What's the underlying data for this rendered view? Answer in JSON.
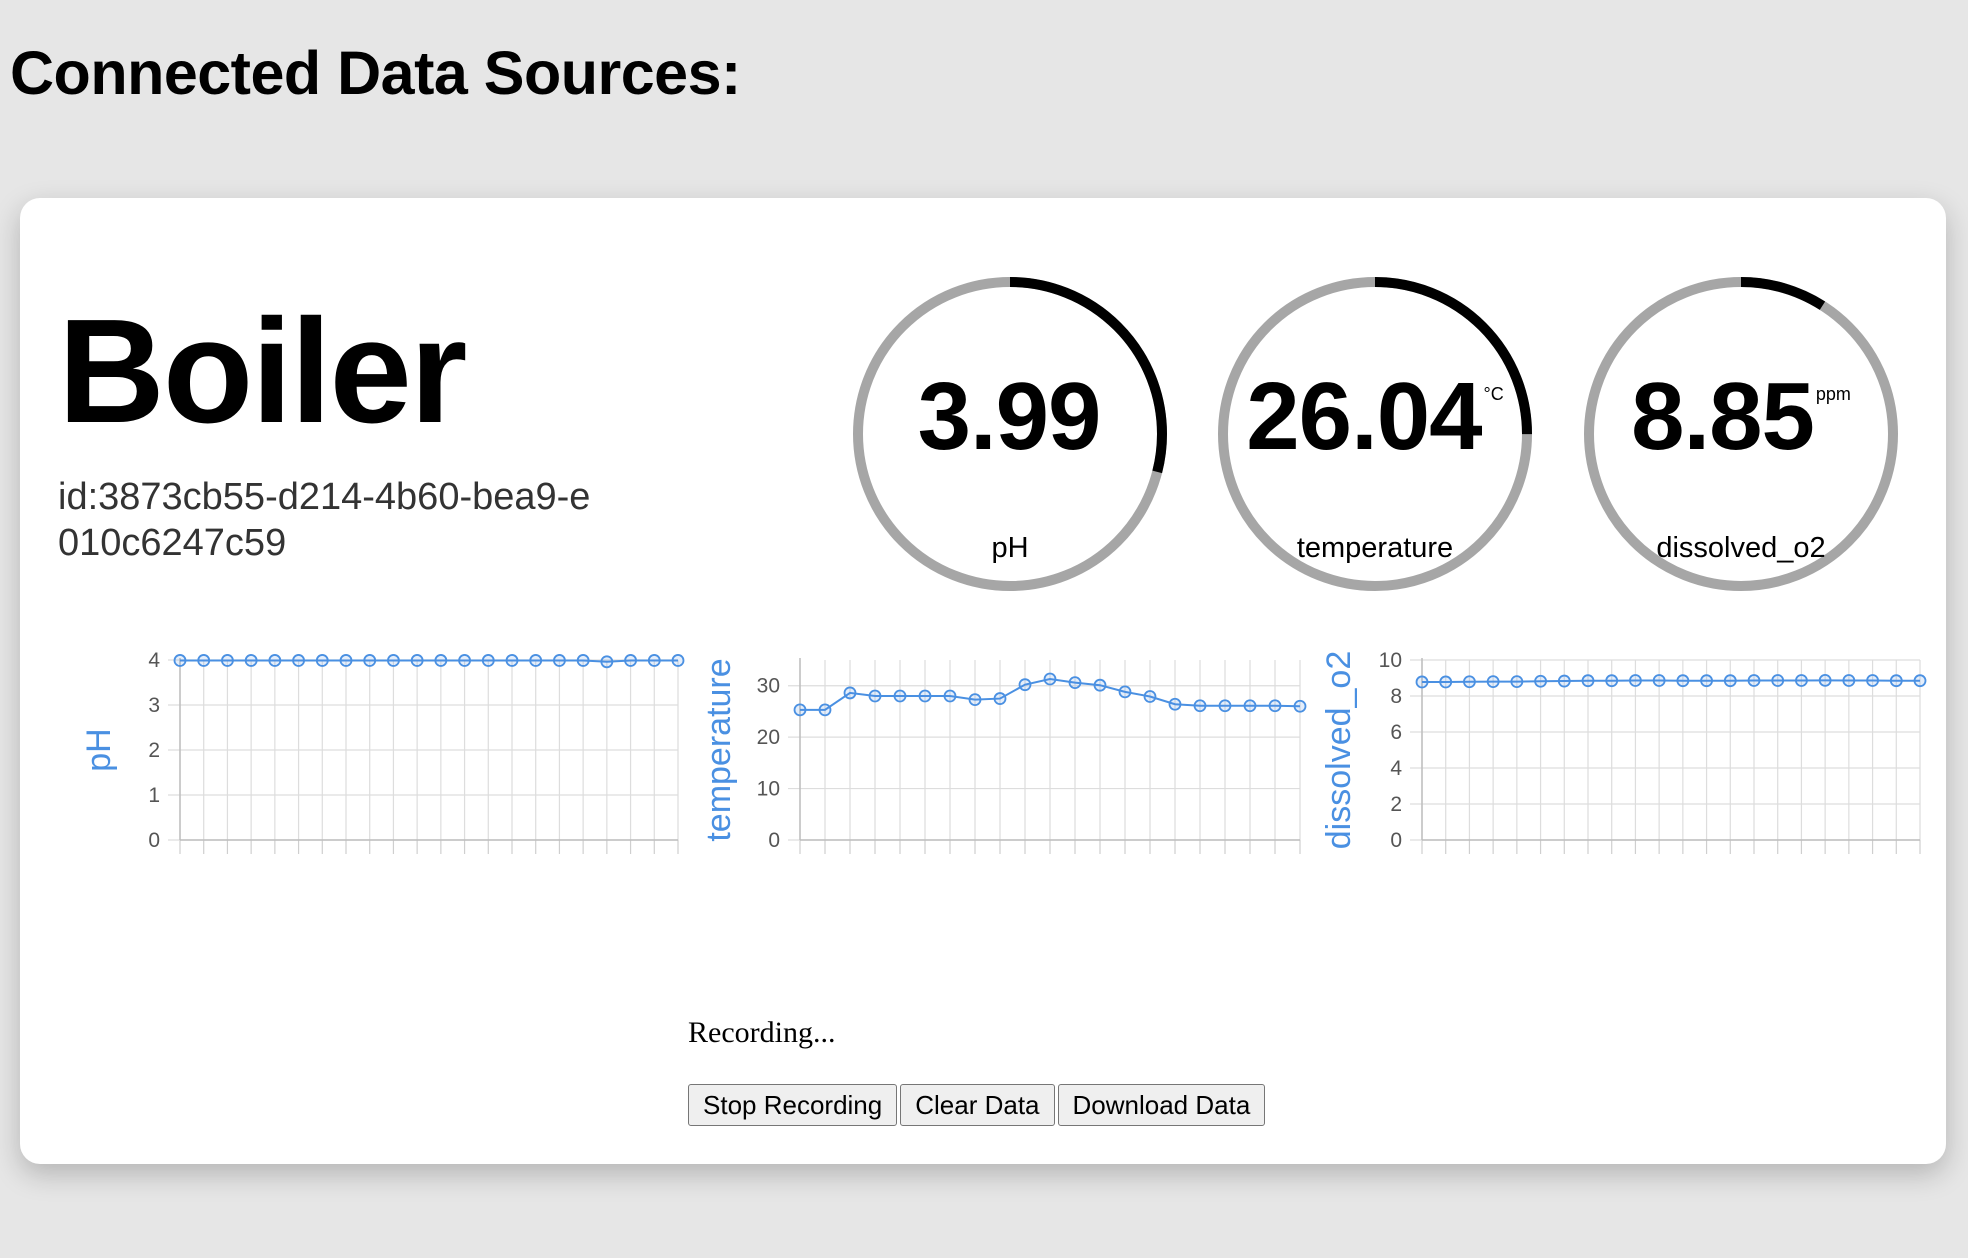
{
  "page": {
    "title": "Connected Data Sources:"
  },
  "device": {
    "name": "Boiler",
    "id": "id:3873cb55-d214-4b60-bea9-e010c6247c59"
  },
  "gauges": [
    {
      "label": "pH",
      "value": "3.99",
      "unit": "",
      "fill_fraction": 0.29
    },
    {
      "label": "temperature",
      "value": "26.04",
      "unit": "°C",
      "fill_fraction": 0.25
    },
    {
      "label": "dissolved_o2",
      "value": "8.85",
      "unit": "ppm",
      "fill_fraction": 0.09
    }
  ],
  "colors": {
    "accent": "#4a90e2",
    "gauge_track": "#a6a6a6",
    "gauge_fill": "#000000",
    "grid": "#dddddd",
    "background": "#e6e6e6",
    "card": "#ffffff"
  },
  "chart_data": [
    {
      "type": "line",
      "ylabel": "pH",
      "xlabel": "",
      "ylim": [
        0,
        4
      ],
      "yticks": [
        0,
        1,
        2,
        3,
        4
      ],
      "grid": true,
      "series": [
        {
          "values": [
            3.99,
            3.99,
            3.99,
            3.99,
            3.99,
            3.99,
            3.99,
            3.99,
            3.99,
            3.99,
            3.99,
            3.99,
            3.99,
            3.99,
            3.99,
            3.99,
            3.99,
            3.99,
            3.96,
            3.99,
            3.99,
            3.99
          ]
        }
      ]
    },
    {
      "type": "line",
      "ylabel": "temperature",
      "xlabel": "",
      "ylim": [
        0,
        35
      ],
      "yticks": [
        0,
        10,
        20,
        30
      ],
      "grid": true,
      "series": [
        {
          "values": [
            25.3,
            25.3,
            28.6,
            28.0,
            28.0,
            28.0,
            28.0,
            27.3,
            27.5,
            30.2,
            31.3,
            30.6,
            30.1,
            28.8,
            27.9,
            26.4,
            26.1,
            26.1,
            26.1,
            26.1,
            26.0
          ]
        }
      ]
    },
    {
      "type": "line",
      "ylabel": "dissolved_o2",
      "xlabel": "",
      "ylim": [
        0,
        10
      ],
      "yticks": [
        0,
        2,
        4,
        6,
        8,
        10
      ],
      "grid": true,
      "series": [
        {
          "values": [
            8.78,
            8.78,
            8.79,
            8.8,
            8.8,
            8.82,
            8.83,
            8.85,
            8.85,
            8.86,
            8.86,
            8.85,
            8.85,
            8.85,
            8.86,
            8.86,
            8.86,
            8.87,
            8.86,
            8.86,
            8.85,
            8.85
          ]
        }
      ]
    }
  ],
  "status": {
    "text": "Recording..."
  },
  "buttons": {
    "stop": "Stop Recording",
    "clear": "Clear Data",
    "download": "Download Data"
  }
}
